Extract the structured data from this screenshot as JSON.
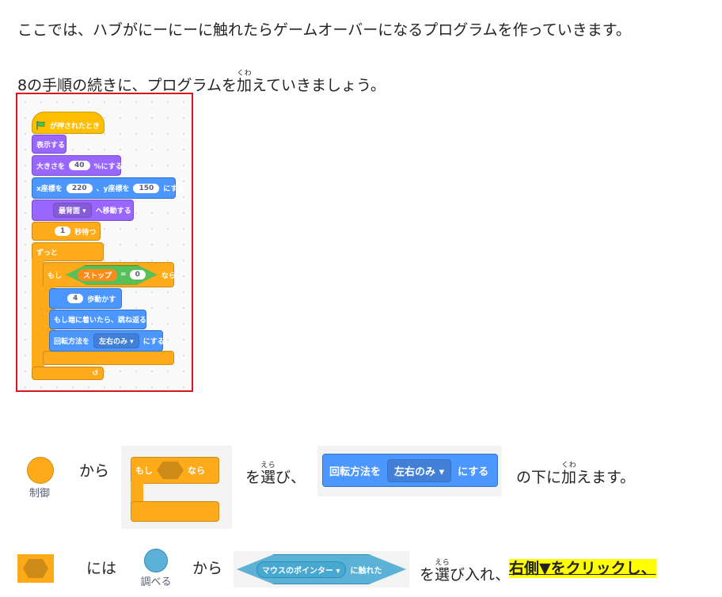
{
  "intro": "ここでは、ハブがにーにーに触れたらゲームオーバーになるプログラムを作っていきます。",
  "step": {
    "before": "8の手順の続きに、プログラムを",
    "ruby_base": "加",
    "ruby_text": "くわ",
    "after": "えていきましょう。"
  },
  "script": {
    "hat": "が押されたとき",
    "show": "表示する",
    "size": {
      "label": "大きさを",
      "value": "40",
      "suffix": "%にする"
    },
    "goto": {
      "x_label": "x座標を",
      "x": "220",
      "sep": "、y座標を",
      "y": "150",
      "suffix": "にする"
    },
    "layer": {
      "option": "最背面",
      "suffix": "へ移動する"
    },
    "wait": {
      "value": "1",
      "suffix": "秒待つ"
    },
    "forever": "ずっと",
    "if": {
      "label": "もし",
      "then": "なら",
      "var": "ストップ",
      "op": "=",
      "value": "0"
    },
    "move": {
      "value": "4",
      "suffix": "歩動かす"
    },
    "bounce": "もし端に着いたら、跳ね返る",
    "rotation": {
      "label": "回転方法を",
      "option": "左右のみ",
      "suffix": "にする"
    }
  },
  "row1": {
    "category": "制御",
    "from": "から",
    "if_block": {
      "label": "もし",
      "then": "なら"
    },
    "select": {
      "ruby_base": "選",
      "ruby_text": "えら",
      "prefix": "を",
      "after": "び、"
    },
    "rotation_block": {
      "label": "回転方法を",
      "option": "左右のみ",
      "suffix": "にする"
    },
    "add": {
      "before": "の下に",
      "ruby_base": "加",
      "ruby_text": "くわ",
      "after": "えます。"
    }
  },
  "row2": {
    "ni_wa": "には",
    "category": "調べる",
    "from": "から",
    "touch_block": {
      "option": "マウスのポインター",
      "suffix": "に触れた"
    },
    "select": {
      "prefix": "を",
      "ruby_base": "選",
      "ruby_text": "えら",
      "after": "び入れ、"
    },
    "highlight": "右側▼をクリックし、"
  },
  "colors": {
    "control": "#ffab19",
    "sensing": "#5cb1d6",
    "motion": "#4c97ff",
    "looks": "#9966ff",
    "operators": "#59c059",
    "frame": "#e0141b",
    "highlight": "#ffff00"
  }
}
